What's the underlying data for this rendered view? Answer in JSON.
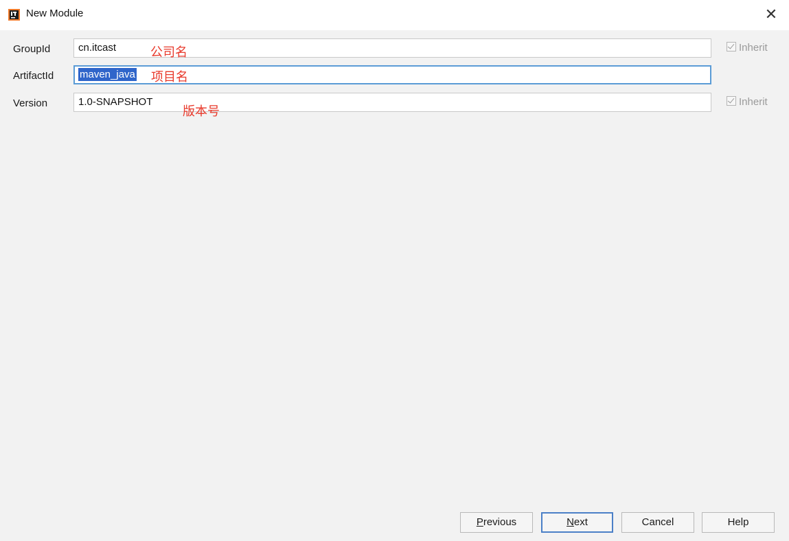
{
  "window": {
    "title": "New Module",
    "close_glyph": "✕"
  },
  "form": {
    "group": {
      "label": "GroupId",
      "value": "cn.itcast",
      "annotation": "公司名",
      "inherit_label": "Inherit",
      "inherit_checked": true
    },
    "artifact": {
      "label": "ArtifactId",
      "value": "maven_java",
      "annotation": "项目名"
    },
    "version": {
      "label": "Version",
      "value": "1.0-SNAPSHOT",
      "annotation": "版本号",
      "inherit_label": "Inherit",
      "inherit_checked": true
    }
  },
  "buttons": {
    "previous": {
      "mnemonic": "P",
      "rest": "revious"
    },
    "next": {
      "mnemonic": "N",
      "rest": "ext"
    },
    "cancel": "Cancel",
    "help": "Help"
  },
  "colors": {
    "accent": "#2f65ca",
    "annotation": "#e8392b",
    "focus_border": "#5a9bd6"
  },
  "icons": {
    "app": "intellij-app-icon",
    "close": "close-icon",
    "checkbox": "checkbox-checked-icon"
  }
}
